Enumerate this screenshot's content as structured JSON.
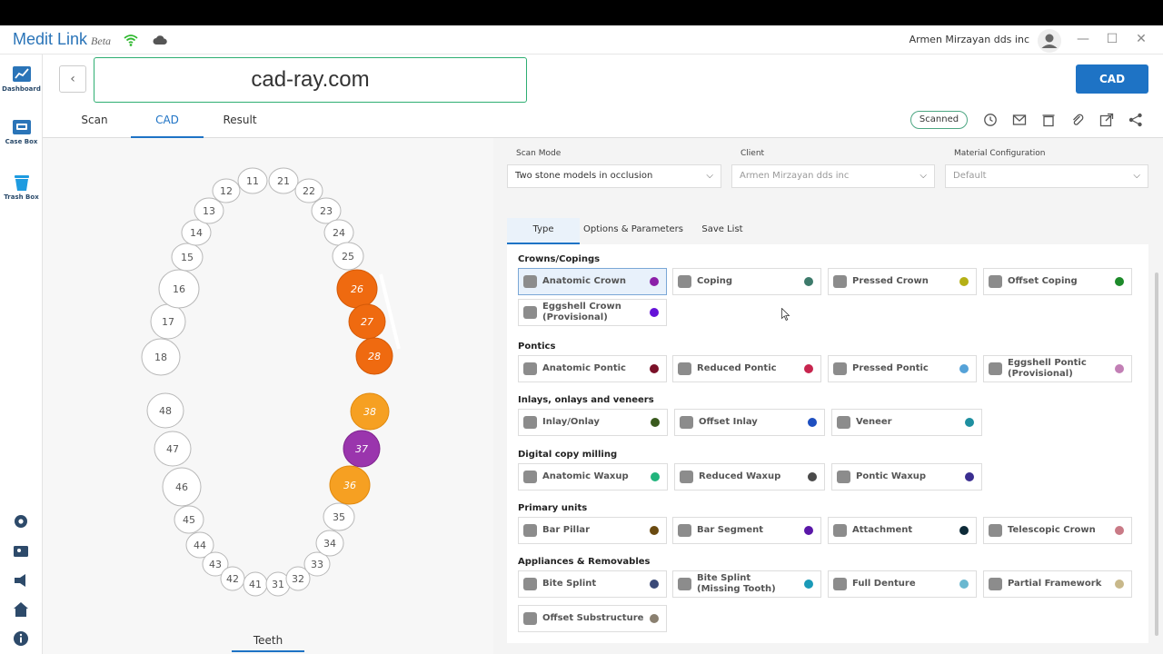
{
  "app": {
    "name": "Medit Link",
    "beta": "Beta",
    "user": "Armen Mirzayan dds inc"
  },
  "window": {
    "minimize": "—",
    "maximize": "☐",
    "close": "✕"
  },
  "sidebar": {
    "items": [
      {
        "label": "Dashboard"
      },
      {
        "label": "Case Box"
      },
      {
        "label": "Trash Box"
      }
    ]
  },
  "header": {
    "back": "‹",
    "case_name": "cad-ray.com",
    "cad_button": "CAD",
    "tabs": [
      {
        "label": "Scan"
      },
      {
        "label": "CAD"
      },
      {
        "label": "Result"
      }
    ],
    "status": "Scanned"
  },
  "fields": {
    "scan_mode": {
      "label": "Scan Mode",
      "value": "Two stone models in occlusion"
    },
    "client": {
      "label": "Client",
      "value": "Armen Mirzayan dds inc"
    },
    "material": {
      "label": "Material Configuration",
      "value": "Default"
    }
  },
  "type_tabs": [
    {
      "label": "Type"
    },
    {
      "label": "Options & Parameters"
    },
    {
      "label": "Save List"
    }
  ],
  "teeth_tab": "Teeth",
  "teeth": {
    "upper": [
      "18",
      "17",
      "16",
      "15",
      "14",
      "13",
      "12",
      "11",
      "21",
      "22",
      "23",
      "24",
      "25",
      "26",
      "27",
      "28"
    ],
    "lower": [
      "48",
      "47",
      "46",
      "45",
      "44",
      "43",
      "42",
      "41",
      "31",
      "32",
      "33",
      "34",
      "35",
      "36",
      "37",
      "38"
    ],
    "orange": [
      "26",
      "27",
      "28"
    ],
    "amber": [
      "38",
      "36"
    ],
    "purple": [
      "37"
    ]
  },
  "sections": [
    {
      "title": "Crowns/Copings",
      "items": [
        {
          "name": "Anatomic Crown",
          "color": "#8b1fa8"
        },
        {
          "name": "Coping",
          "color": "#3d7a6b"
        },
        {
          "name": "Pressed Crown",
          "color": "#b5b015"
        },
        {
          "name": "Offset Coping",
          "color": "#1d8a2a"
        },
        {
          "name": "Eggshell Crown\n(Provisional)",
          "color": "#6412d8"
        }
      ]
    },
    {
      "title": "Pontics",
      "items": [
        {
          "name": "Anatomic Pontic",
          "color": "#7a1028"
        },
        {
          "name": "Reduced Pontic",
          "color": "#c7254e"
        },
        {
          "name": "Pressed Pontic",
          "color": "#55a2d8"
        },
        {
          "name": "Eggshell Pontic\n(Provisional)",
          "color": "#c27fb5"
        }
      ]
    },
    {
      "title": "Inlays, onlays and veneers",
      "items": [
        {
          "name": "Inlay/Onlay",
          "color": "#3a5a1e"
        },
        {
          "name": "Offset Inlay",
          "color": "#1e4fc0"
        },
        {
          "name": "Veneer",
          "color": "#1e8fa0"
        }
      ]
    },
    {
      "title": "Digital copy milling",
      "items": [
        {
          "name": "Anatomic Waxup",
          "color": "#21b47c"
        },
        {
          "name": "Reduced Waxup",
          "color": "#4a4a4a"
        },
        {
          "name": "Pontic Waxup",
          "color": "#3a2e90"
        }
      ]
    },
    {
      "title": "Primary units",
      "items": [
        {
          "name": "Bar Pillar",
          "color": "#6a4a10"
        },
        {
          "name": "Bar Segment",
          "color": "#5a17a8"
        },
        {
          "name": "Attachment",
          "color": "#0d2a38"
        },
        {
          "name": "Telescopic Crown",
          "color": "#c97a86"
        }
      ]
    },
    {
      "title": "Appliances & Removables",
      "items": [
        {
          "name": "Bite Splint",
          "color": "#3a4a78"
        },
        {
          "name": "Bite Splint\n(Missing Tooth)",
          "color": "#1a9ab8"
        },
        {
          "name": "Full Denture",
          "color": "#6ab8d0"
        },
        {
          "name": "Partial Framework",
          "color": "#c8b88a"
        },
        {
          "name": "Offset Substructure",
          "color": "#8a8070"
        }
      ]
    }
  ]
}
